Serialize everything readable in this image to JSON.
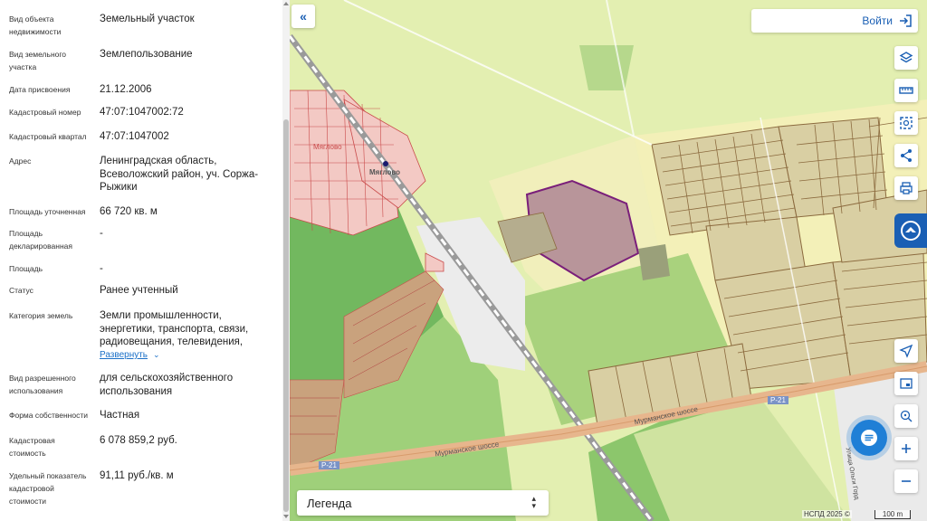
{
  "property": {
    "rows": [
      {
        "label": "Вид объекта недвижимости",
        "value": "Земельный участок"
      },
      {
        "label": "Вид земельного участка",
        "value": "Землепользование"
      },
      {
        "label": "Дата присвоения",
        "value": "21.12.2006"
      },
      {
        "label": "Кадастровый номер",
        "value": "47:07:1047002:72"
      },
      {
        "label": "Кадастровый квартал",
        "value": "47:07:1047002"
      },
      {
        "label": "Адрес",
        "value": "Ленинградская область, Всеволожский район, уч. Соржа-Рыжики"
      },
      {
        "label": "Площадь уточненная",
        "value": "66 720 кв. м"
      },
      {
        "label": "Площадь декларированная",
        "value": "-"
      },
      {
        "label": "Площадь",
        "value": "-"
      },
      {
        "label": "Статус",
        "value": "Ранее учтенный"
      },
      {
        "label": "Категория земель",
        "value": "Земли промышленности, энергетики, транспорта, связи, радиовещания, телевидения,"
      },
      {
        "label": "Вид разрешенного использования",
        "value": "для сельскохозяйственного использования"
      },
      {
        "label": "Форма собственности",
        "value": "Частная"
      },
      {
        "label": "Кадастровая стоимость",
        "value": "6 078 859,2 руб."
      },
      {
        "label": "Удельный показатель кадастровой стоимости",
        "value": "91,11 руб./кв. м"
      }
    ],
    "expand_label": "Развернуть"
  },
  "header": {
    "login_label": "Войти"
  },
  "legend": {
    "label": "Легенда"
  },
  "map": {
    "labels": {
      "village_1": "Мяглово",
      "village_2": "Мяглово",
      "road_name_1": "Мурманское шоссе",
      "road_name_2": "Мурманское шоссе",
      "road_code_1": "Р-21",
      "road_code_2": "Р-21",
      "street": "Улица Ольги Горд"
    },
    "attribution": "НСПД 2025 ©",
    "scale_label": "100 m"
  },
  "colors": {
    "accent": "#1a5fb4",
    "selected_parcel": "#7a1f7a",
    "parcel_border": "#8b6a3e",
    "road": "#e7b68d"
  },
  "icons": {
    "collapse": "double-chevron-left-icon",
    "login": "login-icon",
    "layers": "layers-icon",
    "ruler": "ruler-icon",
    "select": "area-select-icon",
    "share": "share-icon",
    "print": "print-icon",
    "locate": "locate-arrow-icon",
    "minimap": "minimap-icon",
    "search_point": "search-point-icon",
    "zoom_in": "plus-icon",
    "zoom_out": "minus-icon",
    "chat": "chat-icon"
  }
}
